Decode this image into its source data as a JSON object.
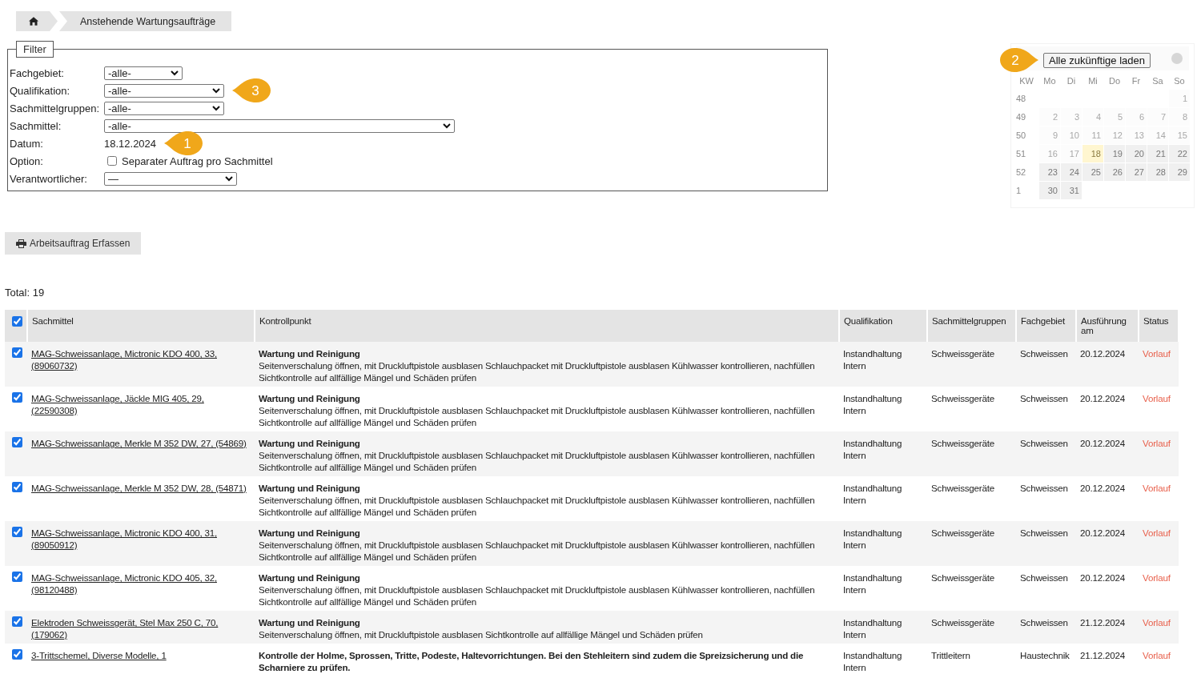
{
  "breadcrumb": {
    "current": "Anstehende Wartungsaufträge"
  },
  "filter": {
    "legend": "Filter",
    "fields": [
      {
        "kind": "select",
        "label": "Fachgebiet:",
        "value": "-alle-"
      },
      {
        "kind": "select",
        "label": "Qualifikation:",
        "value": "-alle-",
        "marker": "3"
      },
      {
        "kind": "select",
        "label": "Sachmittelgruppen:",
        "value": "-alle-"
      },
      {
        "kind": "select",
        "label": "Sachmittel:",
        "value": "-alle-"
      },
      {
        "kind": "text",
        "label": "Datum:",
        "value": "18.12.2024",
        "marker": "1"
      },
      {
        "kind": "checkbox",
        "label": "Option:",
        "value": "Separater Auftrag pro Sachmittel",
        "checked": false
      },
      {
        "kind": "select",
        "label": "Verantwortlicher:",
        "value": "—"
      }
    ]
  },
  "calendar": {
    "button": "Alle zukünftige laden",
    "marker": "2",
    "weekdays": [
      "KW",
      "Mo",
      "Di",
      "Mi",
      "Do",
      "Fr",
      "Sa",
      "So"
    ],
    "weeks": [
      {
        "kw": "48",
        "days": [
          {
            "kind": "blank"
          },
          {
            "kind": "blank"
          },
          {
            "kind": "blank"
          },
          {
            "kind": "blank"
          },
          {
            "kind": "blank"
          },
          {
            "kind": "blank"
          },
          {
            "d": "1",
            "kind": "past"
          }
        ]
      },
      {
        "kw": "49",
        "days": [
          {
            "d": "2",
            "kind": "past"
          },
          {
            "d": "3",
            "kind": "past"
          },
          {
            "d": "4",
            "kind": "past"
          },
          {
            "d": "5",
            "kind": "past"
          },
          {
            "d": "6",
            "kind": "past"
          },
          {
            "d": "7",
            "kind": "past"
          },
          {
            "d": "8",
            "kind": "past"
          }
        ]
      },
      {
        "kw": "50",
        "days": [
          {
            "d": "9",
            "kind": "past"
          },
          {
            "d": "10",
            "kind": "past"
          },
          {
            "d": "11",
            "kind": "past"
          },
          {
            "d": "12",
            "kind": "past"
          },
          {
            "d": "13",
            "kind": "past"
          },
          {
            "d": "14",
            "kind": "past"
          },
          {
            "d": "15",
            "kind": "past"
          }
        ]
      },
      {
        "kw": "51",
        "days": [
          {
            "d": "16",
            "kind": "past"
          },
          {
            "d": "17",
            "kind": "past"
          },
          {
            "d": "18",
            "kind": "today"
          },
          {
            "d": "19",
            "kind": "future"
          },
          {
            "d": "20",
            "kind": "future"
          },
          {
            "d": "21",
            "kind": "future"
          },
          {
            "d": "22",
            "kind": "future"
          }
        ]
      },
      {
        "kw": "52",
        "days": [
          {
            "d": "23",
            "kind": "future"
          },
          {
            "d": "24",
            "kind": "future"
          },
          {
            "d": "25",
            "kind": "future"
          },
          {
            "d": "26",
            "kind": "future"
          },
          {
            "d": "27",
            "kind": "future"
          },
          {
            "d": "28",
            "kind": "future"
          },
          {
            "d": "29",
            "kind": "future"
          }
        ]
      },
      {
        "kw": "1",
        "days": [
          {
            "d": "30",
            "kind": "future"
          },
          {
            "d": "31",
            "kind": "future"
          },
          {
            "kind": "blank"
          },
          {
            "kind": "blank"
          },
          {
            "kind": "blank"
          },
          {
            "kind": "blank"
          },
          {
            "kind": "blank"
          }
        ]
      }
    ]
  },
  "action_button": "Arbeitsauftrag Erfassen",
  "total": "Total: 19",
  "table": {
    "all_checked": true,
    "columns": [
      "Sachmittel",
      "Kontrollpunkt",
      "Qualifikation",
      "Sachmittelgruppen",
      "Fachgebiet",
      "Ausführung am",
      "Status"
    ],
    "rows": [
      {
        "checked": true,
        "sachmittel": "MAG-Schweissanlage, Mictronic KDO 400, 33, (89060732)",
        "title": "Wartung und Reinigung",
        "description": "Seitenverschalung öffnen, mit Druckluftpistole ausblasen Schlauchpacket mit Druckluftpistole ausblasen Kühlwasser kontrollieren, nachfüllen Sichtkontrolle auf allfällige Mängel und Schäden prüfen",
        "qualifikation": "Instandhaltung Intern",
        "gruppe": "Schweissgeräte",
        "fachgebiet": "Schweissen",
        "datum": "20.12.2024",
        "status": "Vorlauf"
      },
      {
        "checked": true,
        "sachmittel": "MAG-Schweissanlage, Jäckle MIG 405, 29, (22590308)",
        "title": "Wartung und Reinigung",
        "description": "Seitenverschalung öffnen, mit Druckluftpistole ausblasen Schlauchpacket mit Druckluftpistole ausblasen Kühlwasser kontrollieren, nachfüllen Sichtkontrolle auf allfällige Mängel und Schäden prüfen",
        "qualifikation": "Instandhaltung Intern",
        "gruppe": "Schweissgeräte",
        "fachgebiet": "Schweissen",
        "datum": "20.12.2024",
        "status": "Vorlauf"
      },
      {
        "checked": true,
        "sachmittel": "MAG-Schweissanlage, Merkle M 352 DW, 27, (54869)",
        "title": "Wartung und Reinigung",
        "description": "Seitenverschalung öffnen, mit Druckluftpistole ausblasen Schlauchpacket mit Druckluftpistole ausblasen Kühlwasser kontrollieren, nachfüllen Sichtkontrolle auf allfällige Mängel und Schäden prüfen",
        "qualifikation": "Instandhaltung Intern",
        "gruppe": "Schweissgeräte",
        "fachgebiet": "Schweissen",
        "datum": "20.12.2024",
        "status": "Vorlauf"
      },
      {
        "checked": true,
        "sachmittel": "MAG-Schweissanlage, Merkle M 352 DW, 28, (54871)",
        "title": "Wartung und Reinigung",
        "description": "Seitenverschalung öffnen, mit Druckluftpistole ausblasen Schlauchpacket mit Druckluftpistole ausblasen Kühlwasser kontrollieren, nachfüllen Sichtkontrolle auf allfällige Mängel und Schäden prüfen",
        "qualifikation": "Instandhaltung Intern",
        "gruppe": "Schweissgeräte",
        "fachgebiet": "Schweissen",
        "datum": "20.12.2024",
        "status": "Vorlauf"
      },
      {
        "checked": true,
        "sachmittel": "MAG-Schweissanlage, Mictronic KDO 400, 31, (89050912)",
        "title": "Wartung und Reinigung",
        "description": "Seitenverschalung öffnen, mit Druckluftpistole ausblasen Schlauchpacket mit Druckluftpistole ausblasen Kühlwasser kontrollieren, nachfüllen Sichtkontrolle auf allfällige Mängel und Schäden prüfen",
        "qualifikation": "Instandhaltung Intern",
        "gruppe": "Schweissgeräte",
        "fachgebiet": "Schweissen",
        "datum": "20.12.2024",
        "status": "Vorlauf"
      },
      {
        "checked": true,
        "sachmittel": "MAG-Schweissanlage, Mictronic KDO 405, 32, (98120488)",
        "title": "Wartung und Reinigung",
        "description": "Seitenverschalung öffnen, mit Druckluftpistole ausblasen Schlauchpacket mit Druckluftpistole ausblasen Kühlwasser kontrollieren, nachfüllen Sichtkontrolle auf allfällige Mängel und Schäden prüfen",
        "qualifikation": "Instandhaltung Intern",
        "gruppe": "Schweissgeräte",
        "fachgebiet": "Schweissen",
        "datum": "20.12.2024",
        "status": "Vorlauf"
      },
      {
        "checked": true,
        "sachmittel": "Elektroden Schweissgerät, Stel Max 250 C, 70, (179062)",
        "title": "Wartung und Reinigung",
        "description": "Seitenverschalung öffnen, mit Druckluftpistole ausblasen Sichtkontrolle auf allfällige Mängel und Schäden prüfen",
        "qualifikation": "Instandhaltung Intern",
        "gruppe": "Schweissgeräte",
        "fachgebiet": "Schweissen",
        "datum": "21.12.2024",
        "status": "Vorlauf"
      },
      {
        "checked": true,
        "sachmittel": "3-Trittschemel, Diverse Modelle, 1",
        "title": "Kontrolle der Holme, Sprossen, Tritte, Podeste, Haltevorrichtungen. Bei den Stehleitern sind zudem die Spreizsicherung und die Scharniere zu prüfen.",
        "qualifikation": "Instandhaltung Intern",
        "gruppe": "Trittleitern",
        "fachgebiet": "Haustechnik",
        "datum": "21.12.2024",
        "status": "Vorlauf"
      }
    ]
  }
}
